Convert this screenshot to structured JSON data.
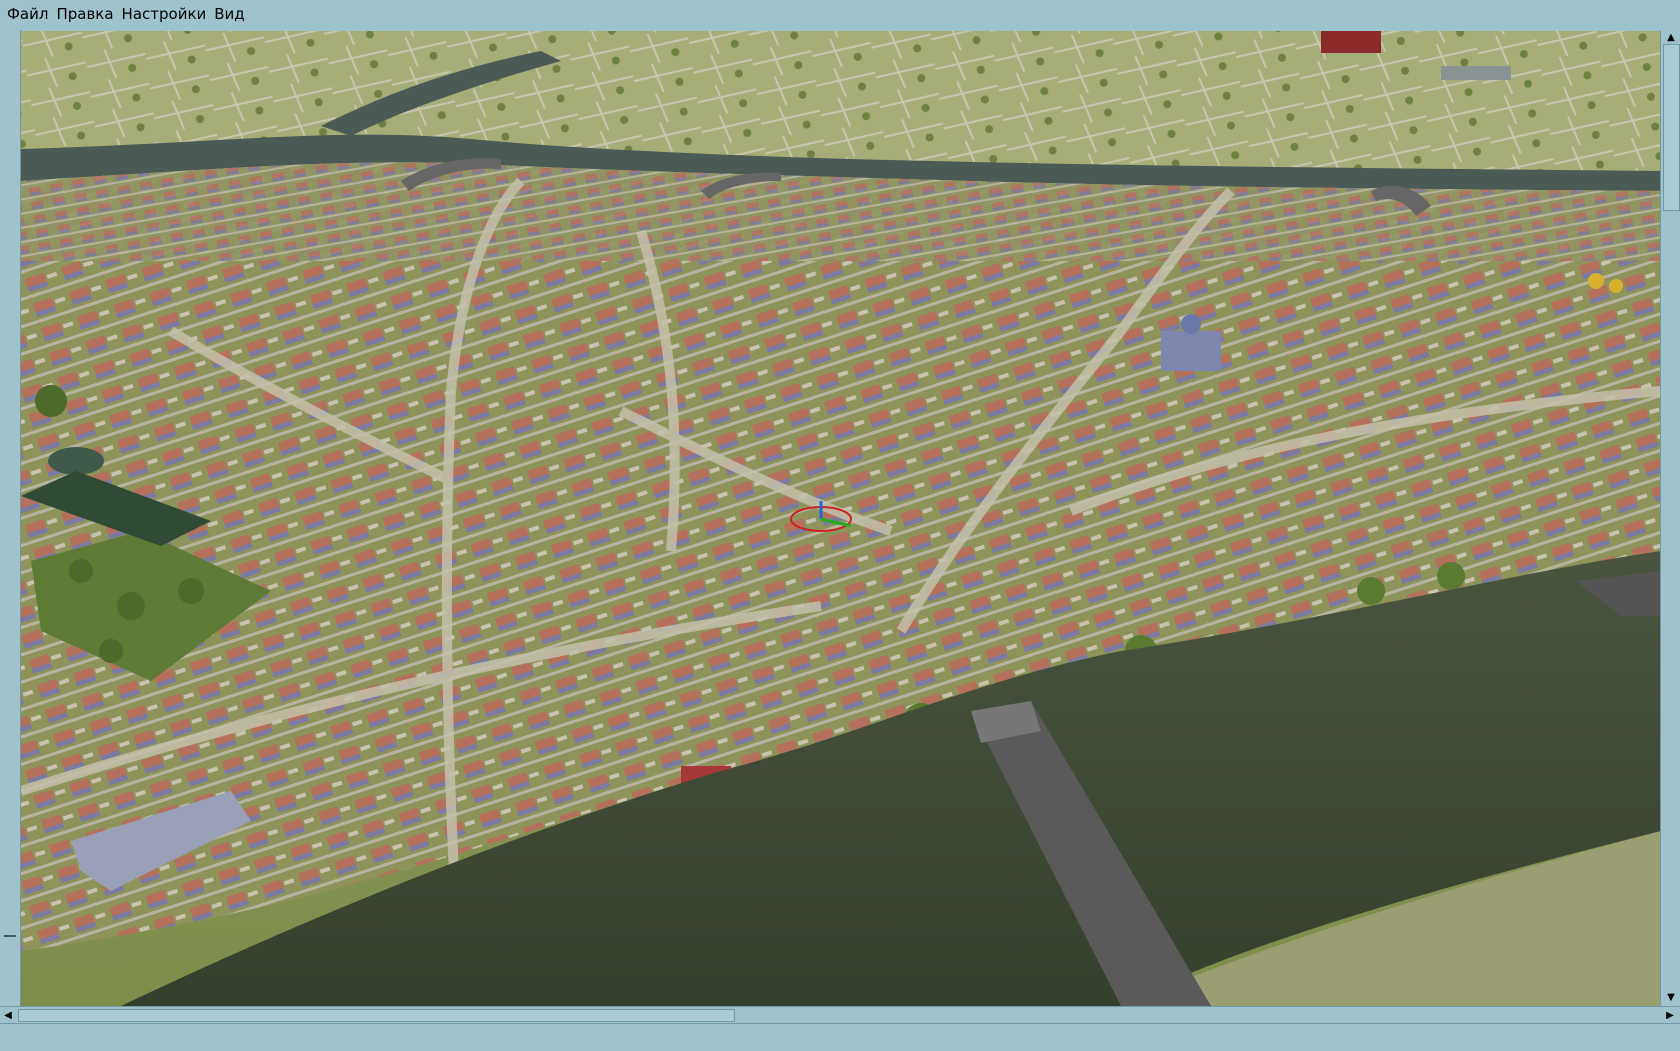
{
  "menu": {
    "items": [
      {
        "label": "Файл"
      },
      {
        "label": "Правка"
      },
      {
        "label": "Настройки"
      },
      {
        "label": "Вид"
      }
    ]
  },
  "scrollbars": {
    "up_icon": "triangle-up-icon",
    "down_icon": "triangle-down-icon",
    "left_icon": "triangle-left-icon",
    "right_icon": "triangle-right-icon"
  },
  "status": {
    "text": ""
  },
  "colors": {
    "chrome": "#9fc3cc",
    "river": "#3e4a35",
    "terrain": "#8a9a55",
    "roof": "#b0705a",
    "bridge": "#555555"
  }
}
